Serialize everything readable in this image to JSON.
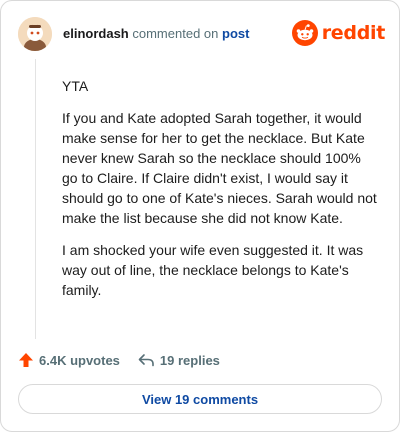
{
  "header": {
    "username": "elinordash",
    "action_text": "commented on",
    "post_link": "post",
    "logo_text": "reddit"
  },
  "comment": {
    "paragraphs": [
      "YTA",
      "If you and Kate adopted Sarah together, it would make sense for her to get the necklace. But Kate never knew Sarah so the necklace should 100% go to Claire. If Claire didn't exist, I would say it should go to one of Kate's nieces. Sarah would not make the list because she did not know Kate.",
      "I am shocked your wife even suggested it. It was way out of line, the necklace belongs to Kate's family."
    ]
  },
  "footer": {
    "upvotes": "6.4K upvotes",
    "replies": "19 replies",
    "view_button": "View 19 comments"
  },
  "colors": {
    "brand": "#ff4500",
    "link": "#0f4aa3",
    "muted": "#576f76",
    "upvote": "#ff4500"
  }
}
